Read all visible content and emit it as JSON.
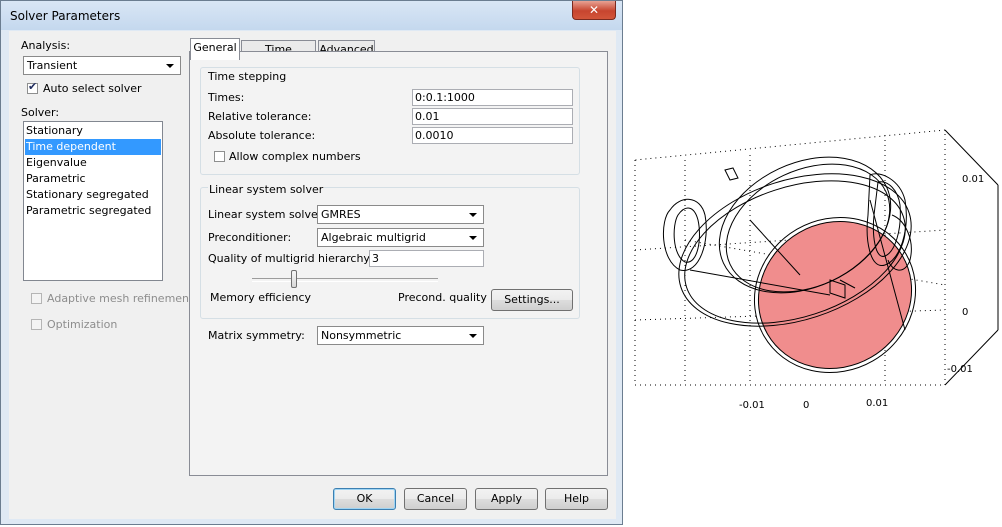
{
  "window": {
    "title": "Solver Parameters",
    "close_glyph": "✕"
  },
  "analysis": {
    "label": "Analysis:",
    "value": "Transient",
    "auto_select_label": "Auto select solver",
    "auto_select_checked": true
  },
  "solver": {
    "label": "Solver:",
    "items": [
      "Stationary",
      "Time dependent",
      "Eigenvalue",
      "Parametric",
      "Stationary segregated",
      "Parametric segregated"
    ],
    "selected": "Time dependent"
  },
  "options": {
    "adaptive_mesh": "Adaptive mesh refinement",
    "optimization": "Optimization"
  },
  "tabs": [
    {
      "label": "General",
      "active": true
    },
    {
      "label": "Time Stepping",
      "active": false
    },
    {
      "label": "Advanced",
      "active": false
    }
  ],
  "time_stepping": {
    "group_title": "Time stepping",
    "times_label": "Times:",
    "times_value": "0:0.1:1000",
    "rel_tol_label": "Relative tolerance:",
    "rel_tol_value": "0.01",
    "abs_tol_label": "Absolute tolerance:",
    "abs_tol_value": "0.0010",
    "complex_label": "Allow complex numbers"
  },
  "linear_solver": {
    "group_title": "Linear system solver",
    "solver_label": "Linear system solver:",
    "solver_value": "GMRES",
    "precond_label": "Preconditioner:",
    "precond_value": "Algebraic multigrid",
    "quality_label": "Quality of multigrid hierarchy:",
    "quality_value": "3",
    "memory_label": "Memory efficiency",
    "precond_quality_label": "Precond. quality",
    "settings_button": "Settings..."
  },
  "matrix": {
    "label": "Matrix symmetry:",
    "value": "Nonsymmetric"
  },
  "buttons": {
    "ok": "OK",
    "cancel": "Cancel",
    "apply": "Apply",
    "help": "Help"
  },
  "plot": {
    "tick_labels_x": [
      "-0.01",
      "0",
      "0.01"
    ],
    "tick_labels_z": [
      "0.01",
      "0",
      "-0.01"
    ],
    "highlight_color": "#f08d8d"
  }
}
